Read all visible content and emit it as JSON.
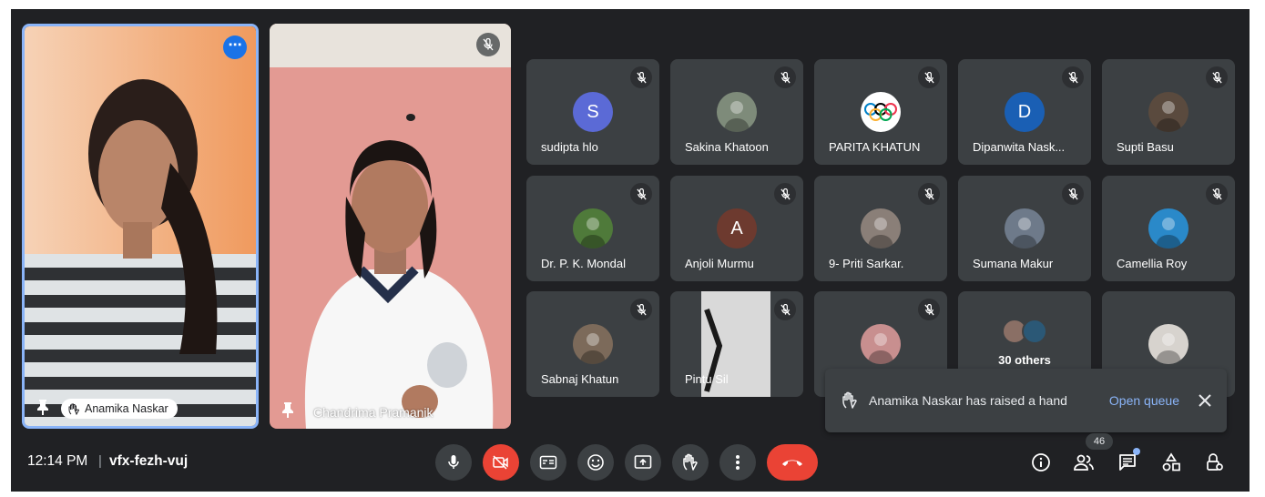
{
  "meeting": {
    "time": "12:14 PM",
    "separator": "|",
    "code": "vfx-fezh-vuj"
  },
  "colors": {
    "background": "#202124",
    "tile": "#3c4043",
    "accent": "#8ab4f8",
    "end_call": "#ea4335"
  },
  "spotlight": [
    {
      "name": "Anamika Naskar",
      "icons": [
        "pin-icon",
        "raised-hand-icon",
        "more-options-icon"
      ]
    },
    {
      "name": "Chandrima Pramanik",
      "icons": [
        "pin-icon",
        "mic-off-icon"
      ]
    }
  ],
  "participants": [
    {
      "name": "sudipta hlo",
      "initial": "S",
      "avatar_color": "#5b6ad6"
    },
    {
      "name": "Sakina Khatoon",
      "initial": "",
      "avatar_color": "#7e8b7a"
    },
    {
      "name": "PARITA KHATUN",
      "initial": "",
      "avatar_color": "#ffffff"
    },
    {
      "name": "Dipanwita Nask...",
      "initial": "D",
      "avatar_color": "#1a5fb4"
    },
    {
      "name": "Supti Basu",
      "initial": "",
      "avatar_color": "#5a4a3e"
    },
    {
      "name": "Dr. P. K. Mondal",
      "initial": "",
      "avatar_color": "#4f7a3a"
    },
    {
      "name": "Anjoli Murmu",
      "initial": "A",
      "avatar_color": "#6d3a2f"
    },
    {
      "name": "9- Priti Sarkar.",
      "initial": "",
      "avatar_color": "#8a7f78"
    },
    {
      "name": "Sumana Makur",
      "initial": "",
      "avatar_color": "#6e7a8a"
    },
    {
      "name": "Camellia Roy",
      "initial": "",
      "avatar_color": "#2a89c9"
    },
    {
      "name": "Sabnaj Khatun",
      "initial": "",
      "avatar_color": "#7c6a5a"
    },
    {
      "name": "Pintu Sil",
      "initial": "",
      "avatar_color": "#d9d9d9"
    },
    {
      "name": "",
      "initial": "",
      "avatar_color": "#c88f8f"
    },
    {
      "name": "30 others",
      "initial": "",
      "avatar_color": "#3c4043"
    },
    {
      "name": "",
      "initial": "",
      "avatar_color": "#d7d3ce"
    }
  ],
  "toast": {
    "message": "Anamika Naskar has raised a hand",
    "action": "Open queue"
  },
  "controls": [
    "mic-icon",
    "camera-off-icon",
    "captions-icon",
    "emoji-icon",
    "present-icon",
    "raise-hand-icon",
    "more-options-icon",
    "end-call-icon"
  ],
  "right_controls": {
    "people_count": "46",
    "icons": [
      "info-icon",
      "people-icon",
      "chat-icon",
      "activities-icon",
      "host-controls-icon"
    ]
  }
}
